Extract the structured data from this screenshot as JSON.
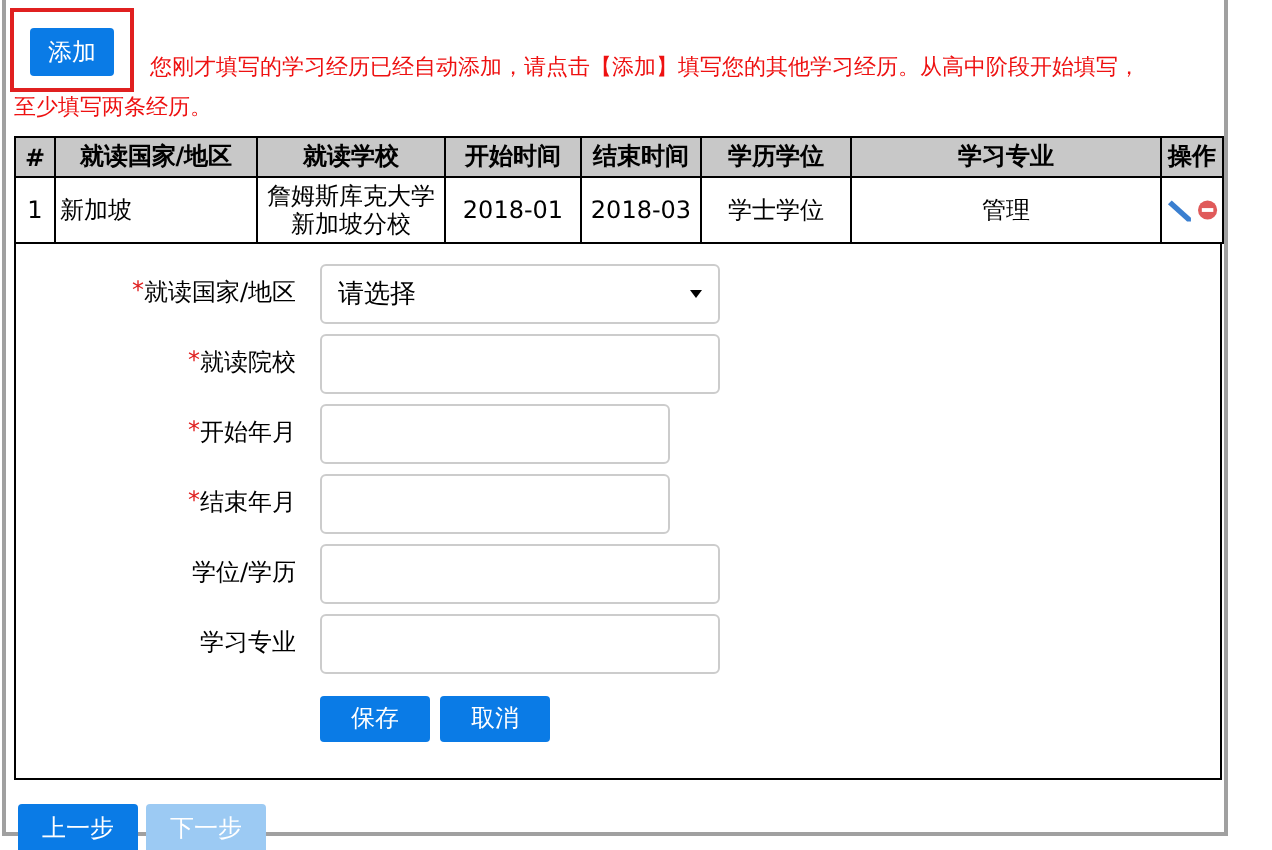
{
  "add_button": {
    "label": "添加",
    "highlighted": true
  },
  "notice_lines": [
    "您刚才填写的学习经历已经自动添加，请点击【添加】填写您的其他学习经历。从高中阶段开始填写，",
    "至少填写两条经历。"
  ],
  "table": {
    "columns": [
      "#",
      "就读国家/地区",
      "就读学校",
      "开始时间",
      "结束时间",
      "学历学位",
      "学习专业",
      "操作"
    ],
    "rows": [
      {
        "cells": [
          "1",
          "新加坡",
          "詹姆斯库克大学新加坡分校",
          "2018-01",
          "2018-03",
          "学士学位",
          "管理"
        ]
      }
    ]
  },
  "form": {
    "fields": [
      {
        "label": "就读国家/地区",
        "marker": "*",
        "kind": "select",
        "value": "请选择"
      },
      {
        "label": "就读院校",
        "marker": "*",
        "kind": "text"
      },
      {
        "label": "开始年月",
        "marker": "*",
        "kind": "month"
      },
      {
        "label": "结束年月",
        "marker": "*",
        "kind": "month"
      },
      {
        "label": "学位/学历",
        "kind": "text"
      },
      {
        "label": "学习专业",
        "kind": "text"
      }
    ],
    "buttons": [
      {
        "label": "保存"
      },
      {
        "label": "取消"
      }
    ]
  },
  "nav_buttons": [
    {
      "label": "上一步",
      "disabled": false
    },
    {
      "label": "下一步",
      "disabled": true
    }
  ]
}
